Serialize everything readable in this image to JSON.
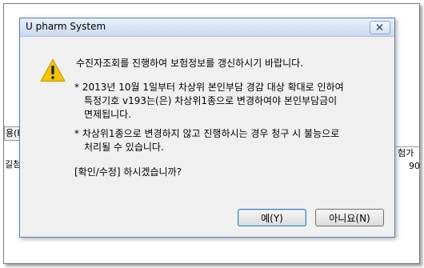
{
  "background": {
    "left_header": "용(F",
    "left_row": "길첨",
    "right_header": "험가",
    "right_row": "90"
  },
  "dialog": {
    "title": "U pharm System",
    "message_line1": "수진자조회를 진행하여 보험정보를 갱신하시기 바랍니다.",
    "note1_line1": "* 2013년 10월 1일부터 차상위 본인부담 경감 대상 확대로 인하여",
    "note1_line2": "특정기호 v193는(은) 차상위1종으로 변경하여야 본인부담금이",
    "note1_line3": "면제됩니다.",
    "note2_line1": "* 차상위1종으로 변경하지 않고 진행하시는 경우 청구 시 불능으로",
    "note2_line2": "처리될 수 있습니다.",
    "question": "[확인/수정] 하시겠습니까?",
    "yes_label": "예(Y)",
    "no_label": "아니요(N)",
    "icon": "warning-icon"
  },
  "colors": {
    "titlebar_top": "#e8f0fb",
    "titlebar_bottom": "#c9daf1",
    "dialog_bg": "#f0f0f0",
    "warning_yellow": "#f5c400"
  }
}
